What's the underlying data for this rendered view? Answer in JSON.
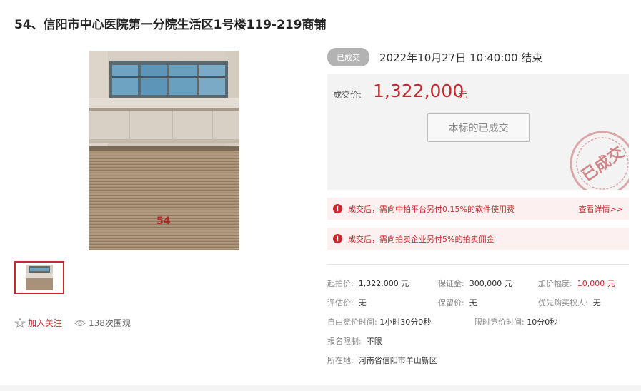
{
  "page": {
    "title": "54、信阳市中心医院第一分院生活区1号楼119-219商铺"
  },
  "photo": {
    "shutter_number": "54",
    "icon": "building-photo"
  },
  "actions": {
    "follow_label": "加入关注",
    "views_label": "138次围观"
  },
  "status": {
    "badge": "已成交",
    "end_time": "2022年10月27日  10:40:00 结束"
  },
  "price": {
    "label": "成交价:",
    "value": "1,322,000",
    "unit": "元",
    "button_label": "本标的已成交",
    "stamp_text": "已成交"
  },
  "notices": [
    {
      "text": "成交后，需向中拍平台另付0.15%的软件使用费",
      "link": "查看详情>>"
    },
    {
      "text": "成交后，需向拍卖企业另付5%的拍卖佣金"
    }
  ],
  "details": {
    "start_price": {
      "k": "起拍价:",
      "v": "1,322,000 元"
    },
    "deposit": {
      "k": "保证金:",
      "v": "300,000 元"
    },
    "increment": {
      "k": "加价幅度:",
      "v": "10,000 元"
    },
    "appraisal": {
      "k": "评估价:",
      "v": "无"
    },
    "reserve": {
      "k": "保留价:",
      "v": "无"
    },
    "priority": {
      "k": "优先购买权人:",
      "v": "无"
    },
    "free_bid": {
      "k": "自由竞价时间:",
      "v": "1小时30分0秒"
    },
    "limited_bid": {
      "k": "限时竞价时间:",
      "v": "10分0秒"
    },
    "restriction": {
      "k": "报名限制:",
      "v": "不限"
    },
    "location": {
      "k": "所在地:",
      "v": "河南省信阳市羊山新区"
    }
  },
  "colors": {
    "accent": "#c8282e",
    "badge_gray": "#b3b3b3",
    "panel_gray": "#f3f3f3",
    "notice_bg": "#fcf0f0"
  }
}
